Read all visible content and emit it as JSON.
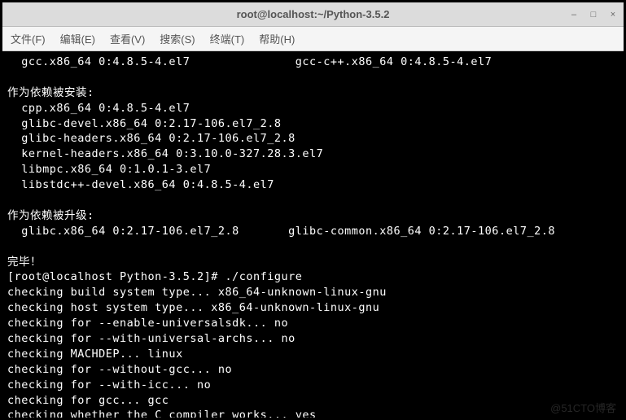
{
  "window": {
    "title": "root@localhost:~/Python-3.5.2"
  },
  "menu": {
    "file": "文件(F)",
    "edit": "编辑(E)",
    "view": "查看(V)",
    "search": "搜索(S)",
    "terminal": "终端(T)",
    "help": "帮助(H)"
  },
  "terminal": {
    "lines": [
      "  gcc.x86_64 0:4.8.5-4.el7               gcc-c++.x86_64 0:4.8.5-4.el7",
      "",
      "作为依赖被安装:",
      "  cpp.x86_64 0:4.8.5-4.el7",
      "  glibc-devel.x86_64 0:2.17-106.el7_2.8",
      "  glibc-headers.x86_64 0:2.17-106.el7_2.8",
      "  kernel-headers.x86_64 0:3.10.0-327.28.3.el7",
      "  libmpc.x86_64 0:1.0.1-3.el7",
      "  libstdc++-devel.x86_64 0:4.8.5-4.el7",
      "",
      "作为依赖被升级:",
      "  glibc.x86_64 0:2.17-106.el7_2.8       glibc-common.x86_64 0:2.17-106.el7_2.8",
      "",
      "完毕！",
      "[root@localhost Python-3.5.2]# ./configure",
      "checking build system type... x86_64-unknown-linux-gnu",
      "checking host system type... x86_64-unknown-linux-gnu",
      "checking for --enable-universalsdk... no",
      "checking for --with-universal-archs... no",
      "checking MACHDEP... linux",
      "checking for --without-gcc... no",
      "checking for --with-icc... no",
      "checking for gcc... gcc",
      "checking whether the C compiler works... yes"
    ]
  },
  "watermark": "@51CTO博客"
}
